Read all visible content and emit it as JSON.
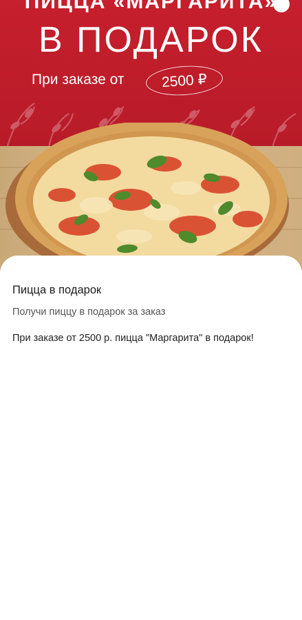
{
  "banner": {
    "top_line": "ПИЦЦА «МАРГАРИТА»",
    "headline": "В ПОДАРОК",
    "condition_text": "При заказе от",
    "price": "2500 ₽",
    "colors": {
      "background": "#c01f2c",
      "text": "#ffffff",
      "table": "#d4b386",
      "crust": "#d9a25a",
      "cheese": "#f3dba0",
      "tomato": "#d63b22",
      "basil": "#4f8a2c"
    }
  },
  "offer": {
    "title": "Пицца в подарок",
    "subtitle": "Получи пиццу в подарок за заказ",
    "description": "При заказе от 2500 р. пицца \"Маргарита\" в подарок!"
  }
}
